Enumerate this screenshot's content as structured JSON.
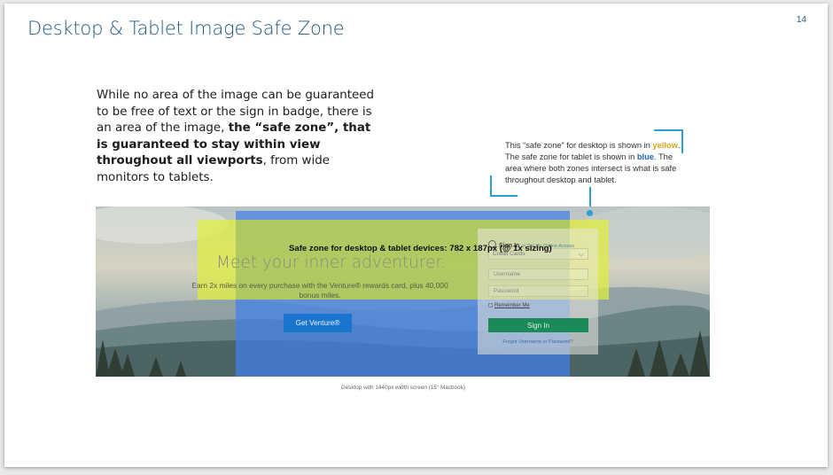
{
  "slide": {
    "title": "Desktop & Tablet Image Safe Zone",
    "page_number": "14"
  },
  "intro": {
    "part1": "While no area of the image can be guaranteed to be free of text or the sign in badge, there is an area of the image, ",
    "bold": "the “safe zone”, that is guaranteed to stay within view throughout all viewports",
    "part2": ", from wide monitors to tablets."
  },
  "note": {
    "part1": "This “safe zone” for desktop is shown in ",
    "yellow_word": "yellow",
    "part2": ". The safe zone for tablet is shown in ",
    "blue_word": "blue",
    "part3": ". The area where both zones intersect is what is safe throughout desktop and tablet."
  },
  "colors": {
    "title": "#215a7a",
    "desktop_zone": "#e1ee3c",
    "tablet_zone": "#4280e6",
    "accent_line": "#2a9fd6",
    "cta": "#1a75cf",
    "signin": "#1a8a58"
  },
  "hero": {
    "zone_caption": "Safe zone for desktop & tablet devices: 782 x 187px (@ 1x sizing)",
    "headline": "Meet your inner adventurer.",
    "subtext": "Earn 2x miles on every purchase with the Venture® rewards card, plus 40,000 bonus miles.",
    "cta_label": "Get Venture®",
    "login": {
      "icon": "user-circle-icon",
      "title": "Sign In",
      "setup_link": "or Set Up Online Access",
      "select_value": "Credit Cards",
      "username_placeholder": "Username",
      "password_placeholder": "Password",
      "remember_label": "Remember Me",
      "signin_label": "Sign In",
      "forgot_label": "Forgot Username or Password?"
    }
  },
  "image_caption": "Desktop with 1440px width screen (15\" Macbook)"
}
